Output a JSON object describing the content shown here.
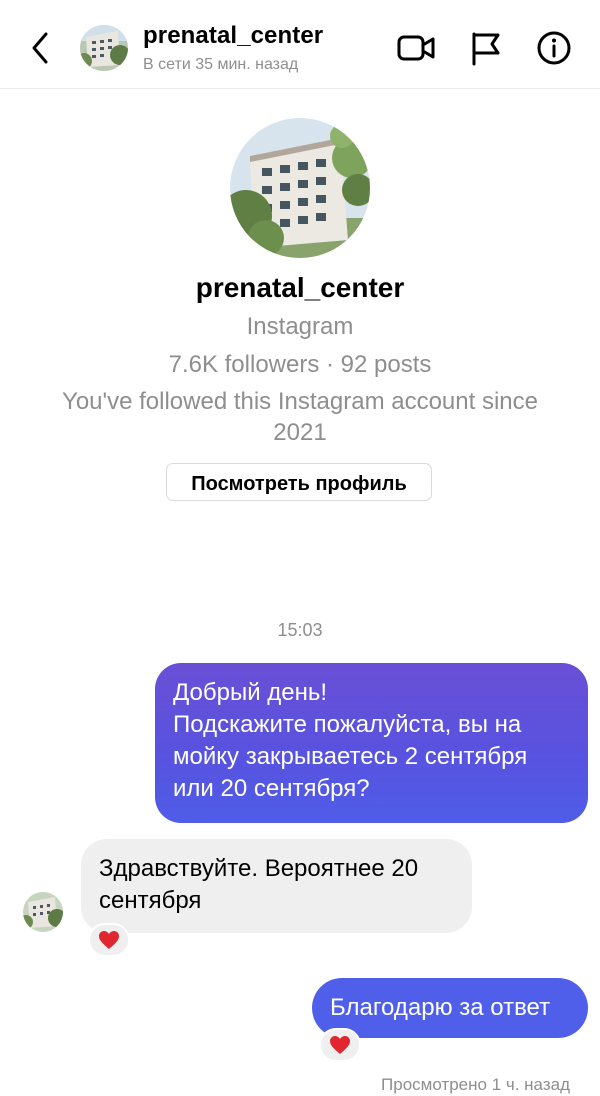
{
  "header": {
    "username": "prenatal_center",
    "status": "В сети 35 мин. назад",
    "icons": [
      "back-chevron-icon",
      "video-call-icon",
      "flag-icon",
      "info-icon"
    ]
  },
  "profile": {
    "username": "prenatal_center",
    "platform": "Instagram",
    "stats": "7.6K followers · 92 posts",
    "followed_since": "You've followed this Instagram account since 2021",
    "view_profile_label": "Посмотреть профиль"
  },
  "chat": {
    "timestamp": "15:03",
    "messages": [
      {
        "from": "me",
        "text": "Добрый день!\nПодскажите пожалуйста, вы на мойку закрываетесь 2 сентября или 20 сентября?"
      },
      {
        "from": "them",
        "text": "Здравствуйте. Вероятнее 20 сентября",
        "reaction": "heart"
      },
      {
        "from": "me",
        "text": "Благодарю за ответ",
        "reaction": "heart"
      }
    ],
    "seen_status": "Просмотрено 1 ч. назад"
  },
  "colors": {
    "outgoing_gradient_top": "#6a4fd6",
    "outgoing_gradient_bottom": "#4f5de8",
    "incoming_bubble": "#efefef",
    "secondary_text": "#8e8e8e",
    "heart": "#e0262e"
  }
}
